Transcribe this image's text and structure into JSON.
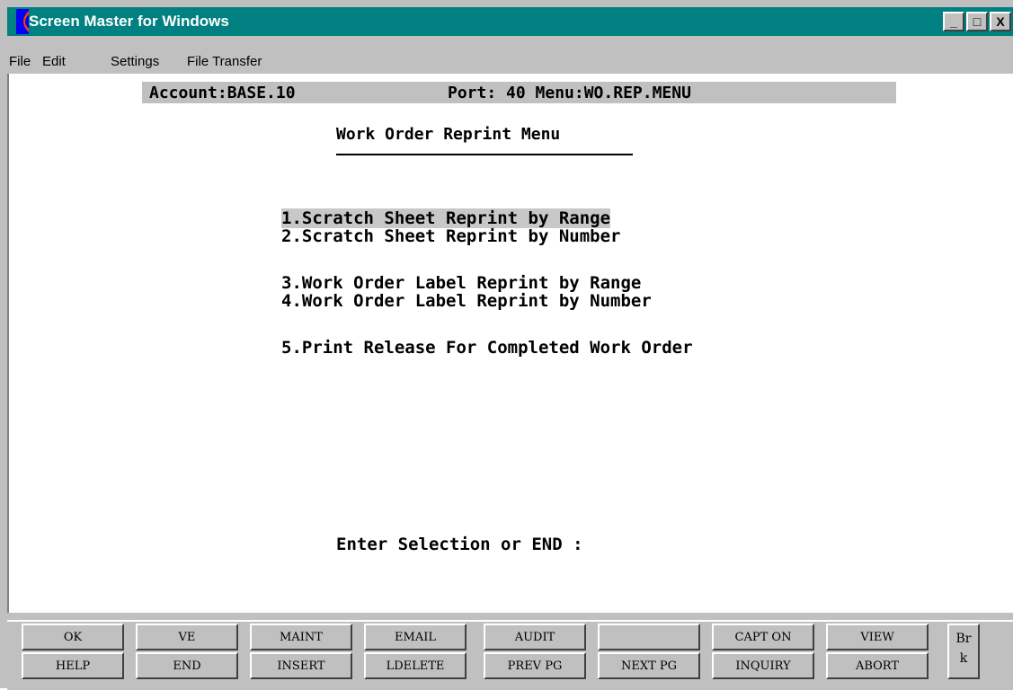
{
  "window": {
    "title": "Screen Master for Windows",
    "controls": [
      "_",
      "□",
      "X"
    ]
  },
  "menubar": {
    "items": [
      "File",
      "Edit",
      "Settings",
      "File Transfer"
    ]
  },
  "status": {
    "account": "Account:BASE.10",
    "port_menu": "Port: 40 Menu:WO.REP.MENU"
  },
  "screen": {
    "title": "Work Order Reprint Menu",
    "options": [
      "1.Scratch Sheet Reprint by Range",
      "2.Scratch Sheet Reprint by Number",
      "3.Work Order Label Reprint by Range",
      "4.Work Order Label Reprint by Number",
      "5.Print Release For Completed Work Order"
    ],
    "prompt": "Enter Selection or END :"
  },
  "function_keys": {
    "row1": [
      "OK",
      "VE",
      "MAINT",
      "EMAIL",
      "AUDIT",
      "",
      "CAPT ON",
      "VIEW"
    ],
    "row2": [
      "HELP",
      "END",
      "INSERT",
      "LDELETE",
      "PREV PG",
      "NEXT PG",
      "INQUIRY",
      "ABORT"
    ],
    "brk_top": "Br",
    "brk_bottom": "k"
  },
  "colors": {
    "titlebar": "#008080",
    "chrome": "#c0c0c0",
    "terminal_bg": "#ffffff"
  }
}
